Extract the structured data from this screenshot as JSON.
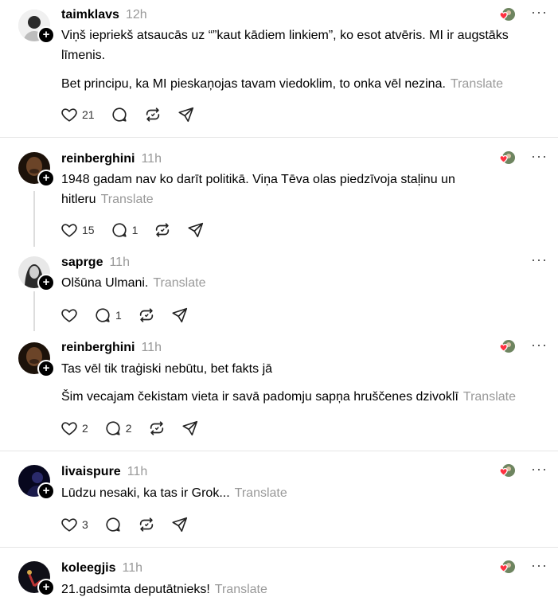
{
  "posts": [
    {
      "username": "taimklavs",
      "time": "12h",
      "paragraphs": [
        "Viņš iepriekš atsaucās uz “”kaut kādiem linkiem”, ko esot atvēris. MI ir augstāks līmenis.",
        "Bet principu, ka MI pieskaņojas tavam viedoklim, to onka vēl nezina."
      ],
      "translate": "Translate",
      "likes": "21",
      "replies": "",
      "avatar_color": "#d8d8d8"
    },
    {
      "username": "reinberghini",
      "time": "11h",
      "paragraphs": [
        "1948 gadam nav ko darīt politikā. Viņa Tēva olas piedzīvoja staļinu un hitleru"
      ],
      "translate": "Translate",
      "likes": "15",
      "replies": "1",
      "avatar_color": "#3a2a1c"
    },
    {
      "username": "saprge",
      "time": "11h",
      "paragraphs": [
        "Olšūna Ulmani."
      ],
      "translate": "Translate",
      "likes": "",
      "replies": "1",
      "avatar_color": "#777777"
    },
    {
      "username": "reinberghini",
      "time": "11h",
      "paragraphs": [
        "Tas vēl tik traģiski nebūtu, bet fakts jā",
        "Šim vecajam čekistam vieta ir savā padomju sapņa hruščenes dzivoklī"
      ],
      "translate": "Translate",
      "likes": "2",
      "replies": "2",
      "avatar_color": "#3a2a1c"
    },
    {
      "username": "livaispure",
      "time": "11h",
      "paragraphs": [
        "Lūdzu nesaki, ka tas ir Grok..."
      ],
      "translate": "Translate",
      "likes": "3",
      "replies": "",
      "avatar_color": "#0c0c2a"
    },
    {
      "username": "koleegjis",
      "time": "11h",
      "paragraphs": [
        "21.gadsimta deputātnieks!"
      ],
      "translate": "Translate",
      "likes": "",
      "replies": "",
      "avatar_color": "#1a1a22"
    }
  ],
  "colors": {
    "heart": "#ff3040",
    "muted": "#999999",
    "divider": "#e5e5e5"
  },
  "icons": [
    "heart-icon",
    "reply-icon",
    "repost-icon",
    "share-icon",
    "more-icon",
    "follow-plus-icon"
  ]
}
